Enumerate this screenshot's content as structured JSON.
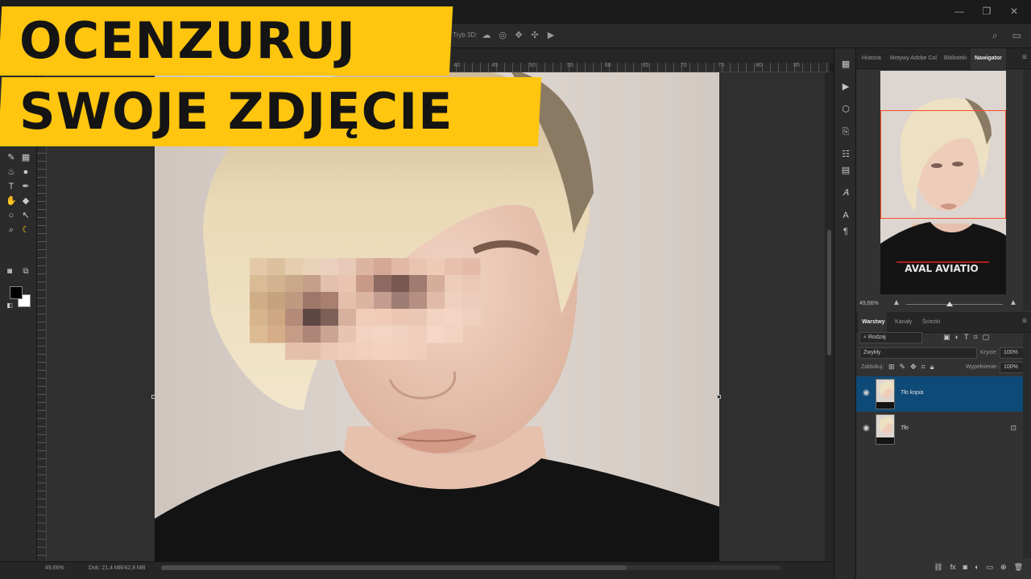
{
  "headline": {
    "line1": "OCENZURUJ",
    "line2": "SWOJE ZDJĘCIE",
    "color": "#ffc50f"
  },
  "options_bar": {
    "mode_3d_label": "Tryb 3D:",
    "icons": [
      "orbit-3d-icon",
      "roll-3d-icon",
      "pan-3d-icon",
      "slide-3d-icon",
      "camera-3d-icon"
    ]
  },
  "rulers": {
    "h_labels": [
      "15",
      "10",
      "5",
      "0",
      "5",
      "10",
      "15",
      "20",
      "25",
      "30",
      "35",
      "40",
      "45",
      "50",
      "55",
      "60",
      "65",
      "70",
      "75",
      "80",
      "85"
    ]
  },
  "status": {
    "zoom": "49,66%",
    "doc": "Dok: 21,4 MB/42,8 MB"
  },
  "top_panel": {
    "tabs": [
      "Historia",
      "Motywy Adobe Col",
      "Biblioteki",
      "Nawigator"
    ],
    "active_tab": "Nawigator"
  },
  "navigator": {
    "zoom": "49,66%",
    "frame_color": "#ff4a2a",
    "shirt_text": "AVAL AVIATIO"
  },
  "layers_panel": {
    "tabs": [
      "Warstwy",
      "Kanały",
      "Ścieżki"
    ],
    "active_tab": "Warstwy",
    "filter_label": "Rodzaj",
    "blend_mode": "Zwykły",
    "opacity_label": "Krycie:",
    "opacity_value": "100%",
    "lock_label": "Zablokuj:",
    "fill_label": "Wypełnienie:",
    "fill_value": "100%",
    "layers": [
      {
        "name": "Tło kopia",
        "selected": true,
        "locked": false
      },
      {
        "name": "Tło",
        "selected": false,
        "locked": true
      }
    ],
    "selected_color": "#0e4a77"
  }
}
